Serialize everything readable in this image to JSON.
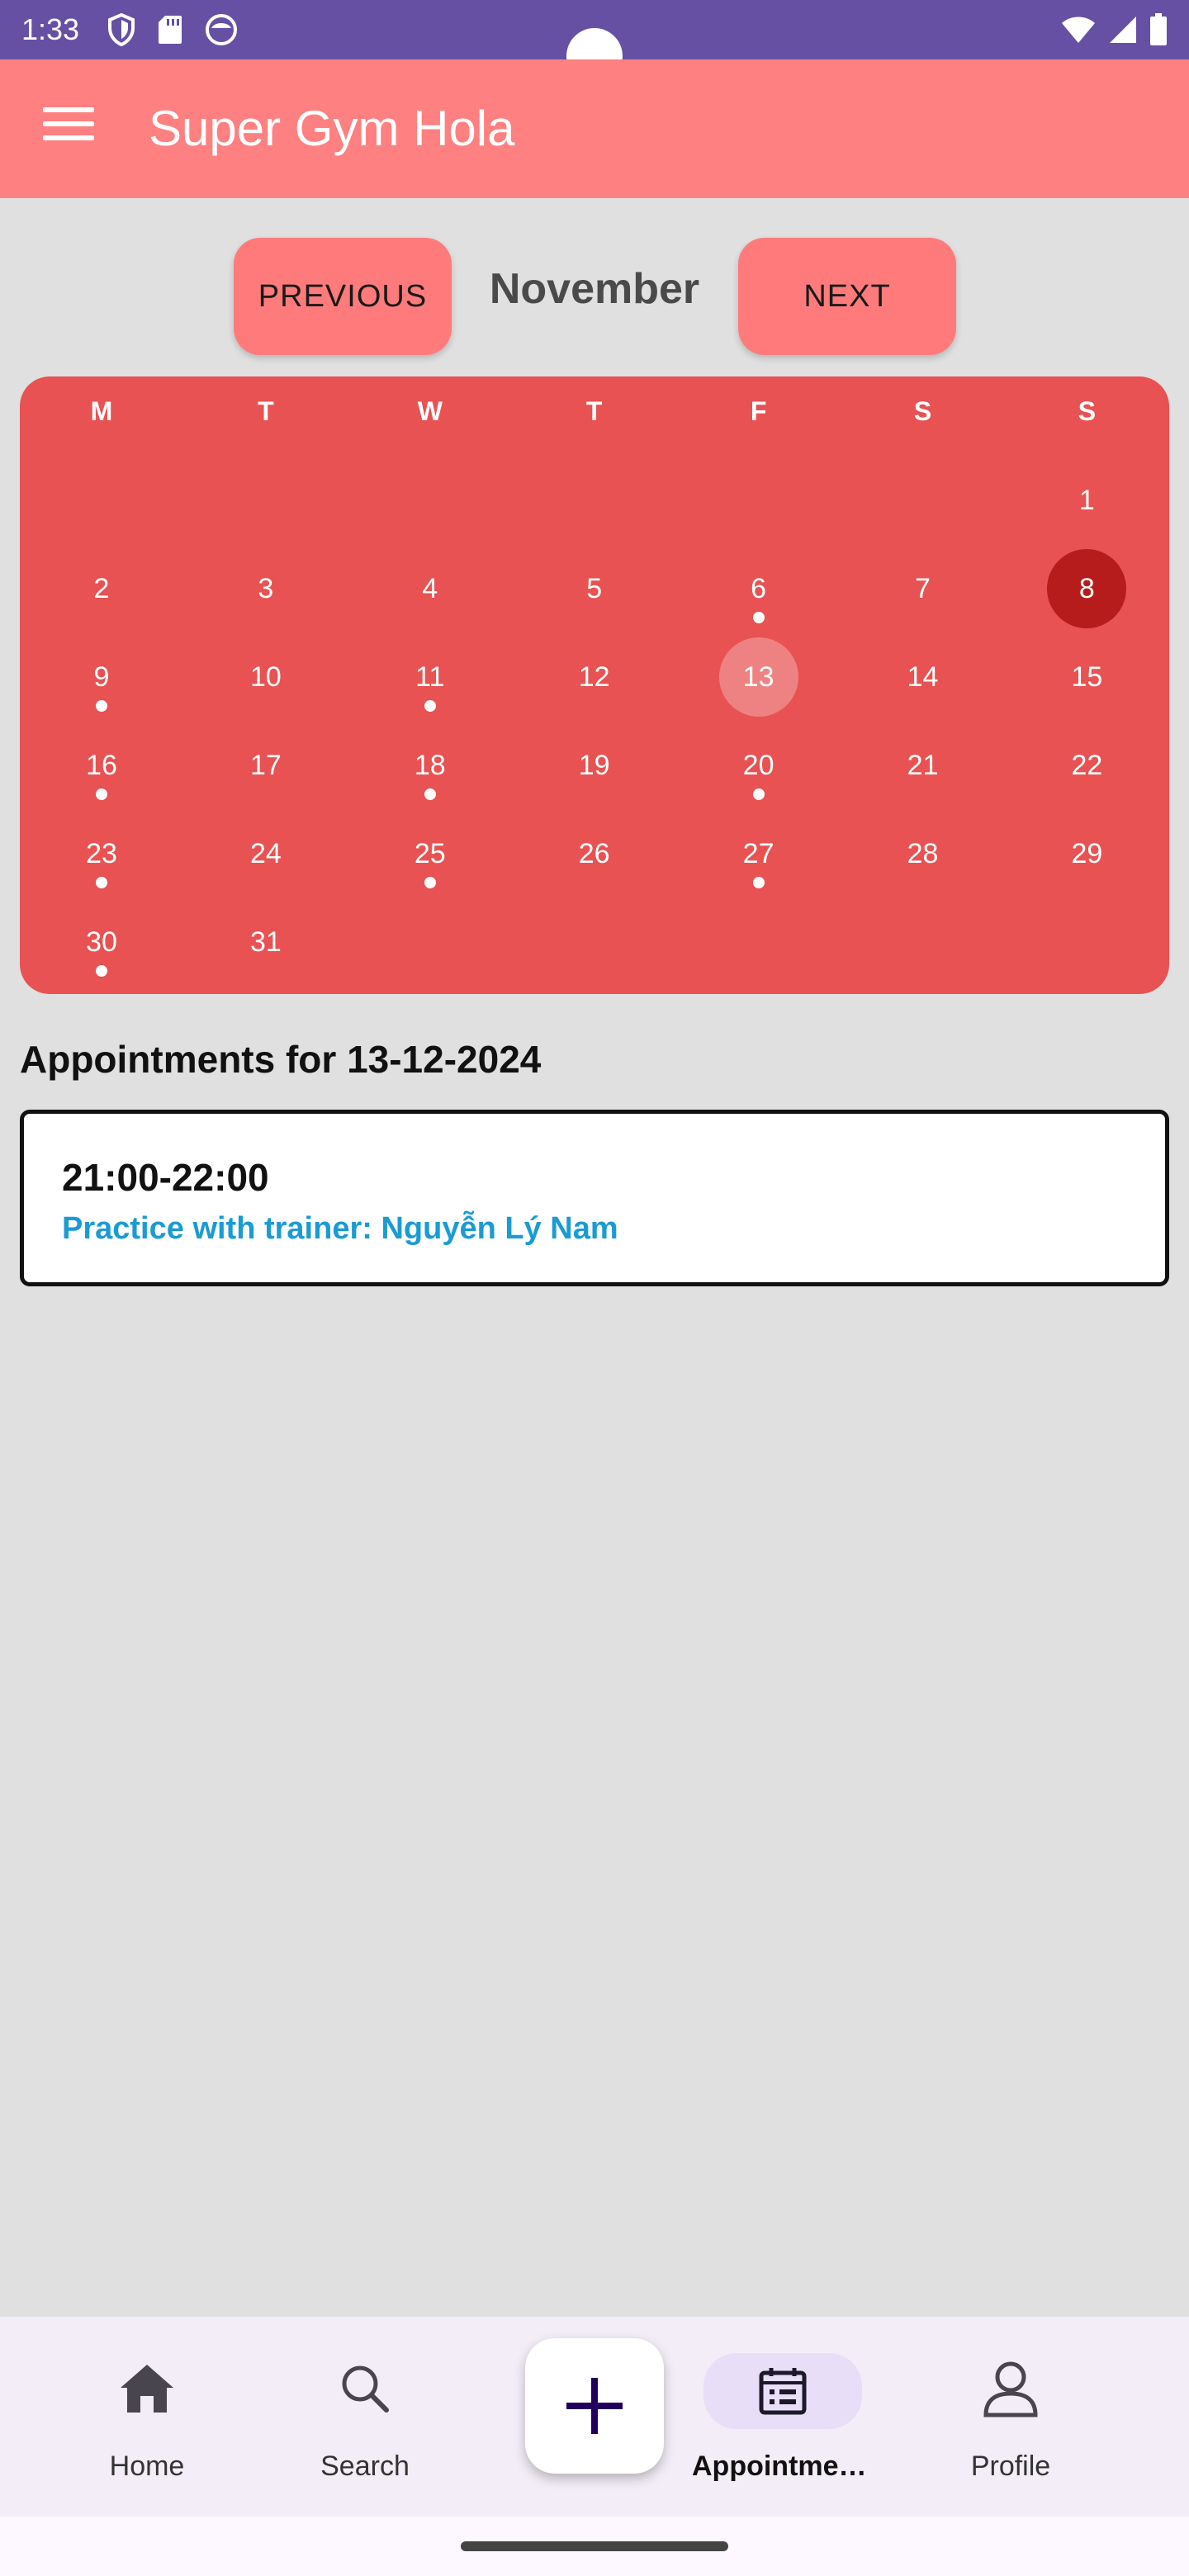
{
  "status_bar": {
    "time": "1:33",
    "left_icons": [
      "shield-icon",
      "sd-card-icon",
      "face-icon"
    ],
    "right_icons": [
      "wifi-icon",
      "signal-icon",
      "battery-icon"
    ]
  },
  "app_bar": {
    "title": "Super Gym Hola",
    "menu_icon": "hamburger-menu-icon"
  },
  "month_nav": {
    "previous_label": "PREVIOUS",
    "next_label": "NEXT",
    "month": "November"
  },
  "calendar": {
    "weekday_headers": [
      "M",
      "T",
      "W",
      "T",
      "F",
      "S",
      "S"
    ],
    "first_weekday_index": 6,
    "days_in_month": 31,
    "selected_day": 8,
    "highlighted_day": 13,
    "days_with_appointments": [
      6,
      9,
      11,
      16,
      18,
      20,
      23,
      25,
      27,
      30
    ],
    "colors": {
      "background": "#e85252",
      "selected": "#b71c1c"
    }
  },
  "appointments": {
    "title": "Appointments for 13-12-2024",
    "items": [
      {
        "time": "21:00-22:00",
        "description": "Practice with trainer: Nguyễn Lý Nam"
      }
    ]
  },
  "bottom_nav": {
    "items": [
      {
        "label": "Home",
        "icon": "home-icon",
        "active": false
      },
      {
        "label": "Search",
        "icon": "search-icon",
        "active": false
      },
      {
        "label": "Appointment...",
        "icon": "calendar-list-icon",
        "active": true
      },
      {
        "label": "Profile",
        "icon": "person-icon",
        "active": false
      }
    ],
    "fab_icon": "plus-icon"
  },
  "colors": {
    "app_bar": "#ff8080",
    "status_bar": "#6650a4",
    "nav_button": "#ff7b7b",
    "appointment_text": "#1a9bd4"
  }
}
